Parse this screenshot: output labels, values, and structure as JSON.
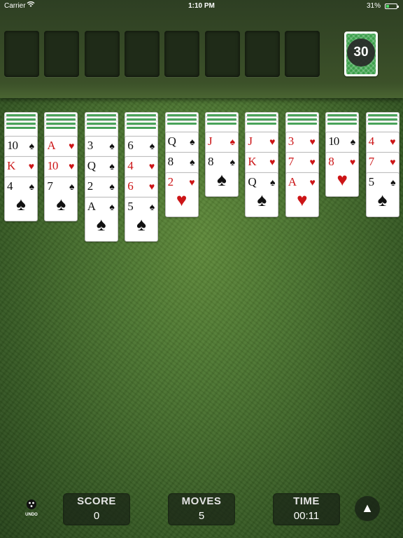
{
  "status_bar": {
    "carrier": "Carrier",
    "wifi_icon": "wifi-icon",
    "time": "1:10 PM",
    "battery_text": "31%",
    "battery_level": 0.31,
    "battery_color": "#4cd964"
  },
  "foundations": {
    "empty_slots": 8
  },
  "stock": {
    "count": "30",
    "back_color": "#3aa04a"
  },
  "tableau": [
    {
      "face_down": 4,
      "cards": [
        {
          "rank": "10",
          "suit": "♠",
          "color": "black"
        },
        {
          "rank": "K",
          "suit": "♥",
          "color": "red"
        },
        {
          "rank": "4",
          "suit": "♠",
          "color": "black"
        }
      ]
    },
    {
      "face_down": 4,
      "cards": [
        {
          "rank": "A",
          "suit": "♥",
          "color": "red"
        },
        {
          "rank": "10",
          "suit": "♥",
          "color": "red"
        },
        {
          "rank": "7",
          "suit": "♠",
          "color": "black"
        }
      ]
    },
    {
      "face_down": 4,
      "cards": [
        {
          "rank": "3",
          "suit": "♠",
          "color": "black"
        },
        {
          "rank": "Q",
          "suit": "♠",
          "color": "black"
        },
        {
          "rank": "2",
          "suit": "♠",
          "color": "black"
        },
        {
          "rank": "A",
          "suit": "♠",
          "color": "black"
        }
      ]
    },
    {
      "face_down": 4,
      "cards": [
        {
          "rank": "6",
          "suit": "♠",
          "color": "black"
        },
        {
          "rank": "4",
          "suit": "♥",
          "color": "red"
        },
        {
          "rank": "6",
          "suit": "♥",
          "color": "red"
        },
        {
          "rank": "5",
          "suit": "♠",
          "color": "black"
        }
      ]
    },
    {
      "face_down": 3,
      "cards": [
        {
          "rank": "Q",
          "suit": "♠",
          "color": "black"
        },
        {
          "rank": "8",
          "suit": "♠",
          "color": "black"
        },
        {
          "rank": "2",
          "suit": "♥",
          "color": "red"
        }
      ]
    },
    {
      "face_down": 3,
      "cards": [
        {
          "rank": "J",
          "suit": "♠",
          "color": "red"
        },
        {
          "rank": "8",
          "suit": "♠",
          "color": "black"
        }
      ]
    },
    {
      "face_down": 3,
      "cards": [
        {
          "rank": "J",
          "suit": "♥",
          "color": "red"
        },
        {
          "rank": "K",
          "suit": "♥",
          "color": "red"
        },
        {
          "rank": "Q",
          "suit": "♠",
          "color": "black"
        }
      ]
    },
    {
      "face_down": 3,
      "cards": [
        {
          "rank": "3",
          "suit": "♥",
          "color": "red"
        },
        {
          "rank": "7",
          "suit": "♥",
          "color": "red"
        },
        {
          "rank": "A",
          "suit": "♥",
          "color": "red"
        }
      ]
    },
    {
      "face_down": 3,
      "cards": [
        {
          "rank": "10",
          "suit": "♠",
          "color": "black"
        },
        {
          "rank": "8",
          "suit": "♥",
          "color": "red"
        }
      ]
    },
    {
      "face_down": 3,
      "cards": [
        {
          "rank": "4",
          "suit": "♥",
          "color": "red"
        },
        {
          "rank": "7",
          "suit": "♥",
          "color": "red"
        },
        {
          "rank": "5",
          "suit": "♠",
          "color": "black"
        }
      ]
    }
  ],
  "bottom_bar": {
    "undo_label": "UNDO",
    "undo_icon": "undo-icon",
    "score_label": "SCORE",
    "score_value": "0",
    "moves_label": "MOVES",
    "moves_value": "5",
    "time_label": "TIME",
    "time_value": "00:11",
    "menu_icon": "triangle-up-icon",
    "menu_glyph": "▲"
  }
}
